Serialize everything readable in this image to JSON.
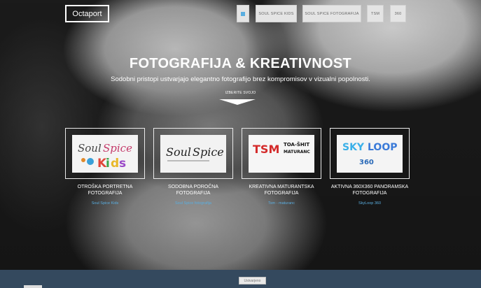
{
  "logo": "Octaport",
  "nav": [
    {
      "label": "",
      "icon": "home-icon"
    },
    {
      "label": "SOUL SPICE KIDS"
    },
    {
      "label": "SOUL SPICE FOTOGRAFIJA"
    },
    {
      "label": "TSM"
    },
    {
      "label": "360"
    }
  ],
  "hero": {
    "title": "FOTOGRAFIJA & KREATIVNOST",
    "subtitle": "Sodobni pristopi ustvarjajo elegantno fotografijo brez kompromisov v vizualni popolnosti.",
    "choose": "IZBERITE SVOJO"
  },
  "cards": [
    {
      "logo_text": "Soul Spice KIDS",
      "title": "OTROŠKA PORTRETNA FOTOGRAFIJA",
      "link": "Soul Spice Kids"
    },
    {
      "logo_text": "Soul Spice",
      "title": "SODOBNA POROČNA FOTOGRAFIJA",
      "link": "Soul Spice fotografija"
    },
    {
      "logo_text": "TSM",
      "title": "KREATIVNA MATURANTSKA FOTOGRAFIJA",
      "link": "Tsm - maturanc"
    },
    {
      "logo_text": "SKYLOOP 360",
      "title": "AKTIVNA 360X360 PANORAMSKA FOTOGRAFIJA",
      "link": "SkyLoop 360"
    }
  ],
  "footer": {
    "button": "Ustvarjeno"
  },
  "colors": {
    "footer": "#34495e",
    "link": "#5aaee0"
  }
}
